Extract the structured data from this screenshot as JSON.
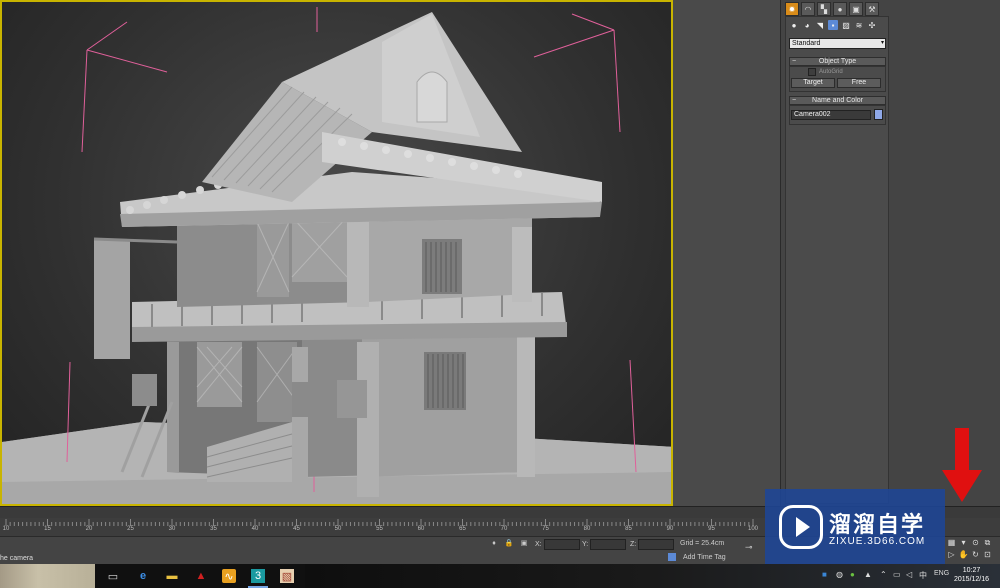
{
  "command_panel": {
    "tab_icons": [
      "create-icon",
      "modify-icon",
      "hierarchy-icon",
      "motion-icon",
      "display-icon",
      "utilities-icon"
    ],
    "subcategory_icons": [
      "geometry-icon",
      "shapes-icon",
      "lights-icon",
      "cameras-icon",
      "helpers-icon",
      "spacewarps-icon",
      "systems-icon"
    ],
    "category_dropdown": "Standard",
    "object_type": {
      "title": "Object Type",
      "autogrid_label": "AutoGrid",
      "buttons": [
        "Target",
        "Free"
      ]
    },
    "name_and_color": {
      "title": "Name and Color",
      "name_value": "Camera002",
      "color": "#8fa8e8"
    }
  },
  "timeline": {
    "ruler_labels": [
      "10",
      "15",
      "20",
      "25",
      "30",
      "35",
      "40",
      "45",
      "50",
      "55",
      "60",
      "65",
      "70",
      "75",
      "80",
      "85",
      "90",
      "95",
      "100"
    ]
  },
  "status_bar": {
    "prompt_text": "he camera",
    "coord_labels": [
      "X:",
      "Y:",
      "Z:"
    ],
    "grid_text": "Grid = 25.4cm",
    "add_time_tag": "Add Time Tag"
  },
  "watermark": {
    "title": "溜溜自学",
    "url": "ZIXUE.3D66.COM"
  },
  "taskbar": {
    "apps": [
      "task-view-icon",
      "edge-icon",
      "file-explorer-icon",
      "autodesk-icon",
      "sketch-icon",
      "3dsmax-icon",
      "photo-viewer-icon"
    ],
    "language": "ENG",
    "time": "10:27",
    "date": "2015/12/16"
  },
  "colors": {
    "viewport_border": "#c8b400",
    "active_tab": "#d98c1a",
    "annotation_arrow": "#e01010"
  }
}
